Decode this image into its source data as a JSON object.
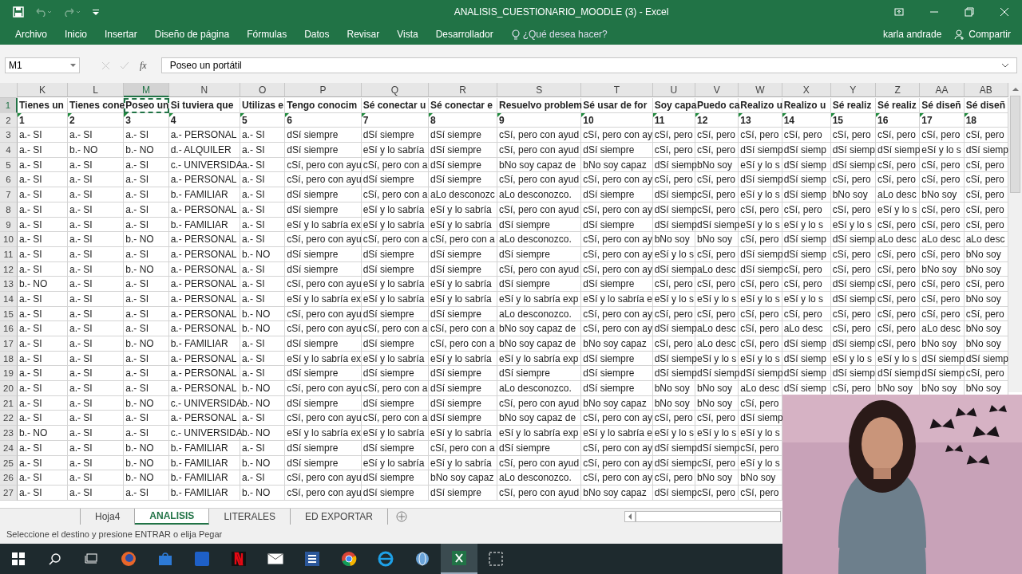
{
  "window": {
    "title": "ANALISIS_CUESTIONARIO_MOODLE (3) - Excel"
  },
  "ribbon": {
    "tabs": [
      {
        "label": "Archivo"
      },
      {
        "label": "Inicio"
      },
      {
        "label": "Insertar"
      },
      {
        "label": "Diseño de página"
      },
      {
        "label": "Fórmulas"
      },
      {
        "label": "Datos"
      },
      {
        "label": "Revisar"
      },
      {
        "label": "Vista"
      },
      {
        "label": "Desarrollador"
      }
    ],
    "tell_me": "¿Qué desea hacer?",
    "user": "karla andrade",
    "share": "Compartir"
  },
  "formula_bar": {
    "name_box": "M1",
    "function_label": "fx",
    "formula": "Poseo un portátil"
  },
  "sheet": {
    "columns": [
      {
        "label": "K",
        "selected": false
      },
      {
        "label": "L",
        "selected": false
      },
      {
        "label": "M",
        "selected": true
      },
      {
        "label": "N",
        "selected": false
      },
      {
        "label": "O",
        "selected": false
      },
      {
        "label": "P",
        "selected": false
      },
      {
        "label": "Q",
        "selected": false
      },
      {
        "label": "R",
        "selected": false
      },
      {
        "label": "S",
        "selected": false
      },
      {
        "label": "T",
        "selected": false
      },
      {
        "label": "U",
        "selected": false
      },
      {
        "label": "V",
        "selected": false
      },
      {
        "label": "W",
        "selected": false
      },
      {
        "label": "X",
        "selected": false
      },
      {
        "label": "Y",
        "selected": false
      },
      {
        "label": "Z",
        "selected": false
      },
      {
        "label": "AA",
        "selected": false
      },
      {
        "label": "AB",
        "selected": false
      }
    ],
    "rows": [
      {
        "number": "1",
        "selected": true,
        "kind": "header",
        "cells": [
          "Tienes un",
          "Tienes cone",
          "Poseo un",
          "Si tuviera que",
          "Utilizas e",
          "Tengo conocim",
          "Sé conectar u",
          "Sé conectar e",
          "Resuelvo problem",
          "Sé usar de for",
          "Soy capa",
          "Puedo ca",
          "Realizo u",
          "Realizo u",
          "Sé realiz",
          "Sé realiz",
          "Sé diseñ",
          "Sé diseñ"
        ]
      },
      {
        "number": "2",
        "selected": false,
        "kind": "number",
        "cells": [
          "1",
          "2",
          "3",
          "4",
          "5",
          "6",
          "7",
          "8",
          "9",
          "10",
          "11",
          "12",
          "13",
          "14",
          "15",
          "16",
          "17",
          "18"
        ]
      },
      {
        "number": "3",
        "selected": false,
        "kind": "data",
        "cells": [
          "a.- SI",
          "a.- SI",
          "a.- SI",
          "a.- PERSONAL",
          "a.- SI",
          "dSí siempre",
          "dSí siempre",
          "dSí siempre",
          "cSí, pero con ayud",
          "cSí, pero con ay",
          "cSí, pero",
          "cSí, pero",
          "cSí, pero",
          "cSí, pero",
          "cSí, pero",
          "cSí, pero",
          "cSí, pero",
          "cSí, pero"
        ]
      },
      {
        "number": "4",
        "selected": false,
        "kind": "data",
        "cells": [
          "a.- SI",
          "b.- NO",
          "b.- NO",
          "d.- ALQUILER",
          "a.- SI",
          "dSí siempre",
          "eSí y lo sabría",
          "dSí siempre",
          "cSí, pero con ayud",
          "dSí siempre",
          "cSí, pero",
          "cSí, pero",
          "dSí siemp",
          "dSí siemp",
          "dSí siemp",
          "dSí siemp",
          "eSí y lo s",
          "dSí siemp"
        ]
      },
      {
        "number": "5",
        "selected": false,
        "kind": "data",
        "cells": [
          "a.- SI",
          "a.- SI",
          "a.- SI",
          "c.- UNIVERSIDA",
          "a.- SI",
          "cSí, pero con ayu",
          "cSí, pero con a",
          "dSí siempre",
          "bNo soy capaz de",
          "bNo soy capaz",
          "dSí siemp",
          "bNo soy",
          "eSí y lo s",
          "dSí siemp",
          "dSí siemp",
          "cSí, pero",
          "cSí, pero",
          "cSí, pero"
        ]
      },
      {
        "number": "6",
        "selected": false,
        "kind": "data",
        "cells": [
          "a.- SI",
          "a.- SI",
          "a.- SI",
          "a.- PERSONAL",
          "a.- SI",
          "cSí, pero con ayu",
          "dSí siempre",
          "dSí siempre",
          "cSí, pero con ayud",
          "cSí, pero con ay",
          "cSí, pero",
          "cSí, pero",
          "dSí siemp",
          "dSí siemp",
          "cSí, pero",
          "cSí, pero",
          "cSí, pero",
          "cSí, pero"
        ]
      },
      {
        "number": "7",
        "selected": false,
        "kind": "data",
        "cells": [
          "a.- SI",
          "a.- SI",
          "a.- SI",
          "b.- FAMILIAR",
          "a.- SI",
          "dSí siempre",
          "cSí, pero con a",
          "aLo desconozc",
          "aLo desconozco.",
          "dSí siempre",
          "dSí siemp",
          "cSí, pero",
          "eSí y lo s",
          "dSí siemp",
          "bNo soy",
          "aLo desc",
          "bNo soy",
          "cSí, pero"
        ]
      },
      {
        "number": "8",
        "selected": false,
        "kind": "data",
        "cells": [
          "a.- SI",
          "a.- SI",
          "a.- SI",
          "a.- PERSONAL",
          "a.- SI",
          "dSí siempre",
          "eSí y lo sabría",
          "eSí y lo sabría",
          "cSí, pero con ayud",
          "cSí, pero con ay",
          "dSí siemp",
          "cSí, pero",
          "cSí, pero",
          "cSí, pero",
          "cSí, pero",
          "eSí y lo s",
          "cSí, pero",
          "cSí, pero"
        ]
      },
      {
        "number": "9",
        "selected": false,
        "kind": "data",
        "cells": [
          "a.- SI",
          "a.- SI",
          "a.- SI",
          "b.- FAMILIAR",
          "a.- SI",
          "eSí y lo sabría ex",
          "eSí y lo sabría",
          "eSí y lo sabría",
          "dSí siempre",
          "dSí siempre",
          "dSí siemp",
          "dSí siemp",
          "eSí y lo s",
          "eSí y lo s",
          "eSí y lo s",
          "cSí, pero",
          "cSí, pero",
          "cSí, pero"
        ]
      },
      {
        "number": "10",
        "selected": false,
        "kind": "data",
        "cells": [
          "a.- SI",
          "a.- SI",
          "b.- NO",
          "a.- PERSONAL",
          "a.- SI",
          "cSí, pero con ayu",
          "cSí, pero con a",
          "cSí, pero con a",
          "aLo desconozco.",
          "cSí, pero con ay",
          "bNo soy",
          "bNo soy",
          "cSí, pero",
          "dSí siemp",
          "dSí siemp",
          "aLo desc",
          "aLo desc",
          "aLo desc"
        ]
      },
      {
        "number": "11",
        "selected": false,
        "kind": "data",
        "cells": [
          "a.- SI",
          "a.- SI",
          "a.- SI",
          "a.- PERSONAL",
          "b.- NO",
          "dSí siempre",
          "dSí siempre",
          "dSí siempre",
          "dSí siempre",
          "cSí, pero con ay",
          "eSí y lo s",
          "cSí, pero",
          "dSí siemp",
          "dSí siemp",
          "cSí, pero",
          "cSí, pero",
          "cSí, pero",
          "bNo soy"
        ]
      },
      {
        "number": "12",
        "selected": false,
        "kind": "data",
        "cells": [
          "a.- SI",
          "a.- SI",
          "b.- NO",
          "a.- PERSONAL",
          "a.- SI",
          "dSí siempre",
          "dSí siempre",
          "dSí siempre",
          "cSí, pero con ayud",
          "cSí, pero con ay",
          "dSí siemp",
          "aLo desc",
          "dSí siemp",
          "cSí, pero",
          "cSí, pero",
          "cSí, pero",
          "bNo soy",
          "bNo soy"
        ]
      },
      {
        "number": "13",
        "selected": false,
        "kind": "data",
        "cells": [
          "b.- NO",
          "a.- SI",
          "a.- SI",
          "a.- PERSONAL",
          "a.- SI",
          "cSí, pero con ayu",
          "eSí y lo sabría",
          "eSí y lo sabría",
          "dSí siempre",
          "dSí siempre",
          "cSí, pero",
          "cSí, pero",
          "cSí, pero",
          "cSí, pero",
          "dSí siemp",
          "cSí, pero",
          "cSí, pero",
          "cSí, pero"
        ]
      },
      {
        "number": "14",
        "selected": false,
        "kind": "data",
        "cells": [
          "a.- SI",
          "a.- SI",
          "a.- SI",
          "a.- PERSONAL",
          "a.- SI",
          "eSí y lo sabría ex",
          "eSí y lo sabría",
          "eSí y lo sabría",
          "eSí y lo sabría exp",
          "eSí y lo sabría e",
          "eSí y lo s",
          "eSí y lo s",
          "eSí y lo s",
          "eSí y lo s",
          "dSí siemp",
          "cSí, pero",
          "cSí, pero",
          "bNo soy"
        ]
      },
      {
        "number": "15",
        "selected": false,
        "kind": "data",
        "cells": [
          "a.- SI",
          "a.- SI",
          "a.- SI",
          "a.- PERSONAL",
          "b.- NO",
          "cSí, pero con ayu",
          "dSí siempre",
          "dSí siempre",
          "aLo desconozco.",
          "cSí, pero con ay",
          "cSí, pero",
          "cSí, pero",
          "cSí, pero",
          "cSí, pero",
          "cSí, pero",
          "cSí, pero",
          "cSí, pero",
          "cSí, pero"
        ]
      },
      {
        "number": "16",
        "selected": false,
        "kind": "data",
        "cells": [
          "a.- SI",
          "a.- SI",
          "a.- SI",
          "a.- PERSONAL",
          "b.- NO",
          "cSí, pero con ayu",
          "cSí, pero con a",
          "cSí, pero con a",
          "bNo soy capaz de",
          "cSí, pero con ay",
          "dSí siemp",
          "aLo desc",
          "cSí, pero",
          "aLo desc",
          "cSí, pero",
          "cSí, pero",
          "aLo desc",
          "bNo soy"
        ]
      },
      {
        "number": "17",
        "selected": false,
        "kind": "data",
        "cells": [
          "a.- SI",
          "a.- SI",
          "b.- NO",
          "b.- FAMILIAR",
          "a.- SI",
          "dSí siempre",
          "dSí siempre",
          "cSí, pero con a",
          "bNo soy capaz de",
          "bNo soy capaz",
          "cSí, pero",
          "aLo desc",
          "cSí, pero",
          "dSí siemp",
          "dSí siemp",
          "cSí, pero",
          "bNo soy",
          "bNo soy"
        ]
      },
      {
        "number": "18",
        "selected": false,
        "kind": "data",
        "cells": [
          "a.- SI",
          "a.- SI",
          "a.- SI",
          "a.- PERSONAL",
          "a.- SI",
          "eSí y lo sabría ex",
          "eSí y lo sabría",
          "eSí y lo sabría",
          "eSí y lo sabría exp",
          "dSí siempre",
          "dSí siemp",
          "eSí y lo s",
          "eSí y lo s",
          "dSí siemp",
          "eSí y lo s",
          "eSí y lo s",
          "dSí siemp",
          "dSí siemp"
        ]
      },
      {
        "number": "19",
        "selected": false,
        "kind": "data",
        "cells": [
          "a.- SI",
          "a.- SI",
          "a.- SI",
          "a.- PERSONAL",
          "a.- SI",
          "dSí siempre",
          "dSí siempre",
          "dSí siempre",
          "dSí siempre",
          "dSí siempre",
          "dSí siemp",
          "dSí siemp",
          "dSí siemp",
          "dSí siemp",
          "dSí siemp",
          "dSí siemp",
          "dSí siemp",
          "cSí, pero"
        ]
      },
      {
        "number": "20",
        "selected": false,
        "kind": "data",
        "cells": [
          "a.- SI",
          "a.- SI",
          "a.- SI",
          "a.- PERSONAL",
          "b.- NO",
          "cSí, pero con ayu",
          "cSí, pero con a",
          "dSí siempre",
          "aLo desconozco.",
          "dSí siempre",
          "bNo soy",
          "bNo soy",
          "aLo desc",
          "dSí siemp",
          "cSí, pero",
          "bNo soy",
          "bNo soy",
          "bNo soy"
        ]
      },
      {
        "number": "21",
        "selected": false,
        "kind": "data",
        "cells": [
          "a.- SI",
          "a.- SI",
          "b.- NO",
          "c.- UNIVERSIDA",
          "b.- NO",
          "dSí siempre",
          "dSí siempre",
          "dSí siempre",
          "cSí, pero con ayud",
          "bNo soy capaz",
          "bNo soy",
          "bNo soy",
          "cSí, pero"
        ]
      },
      {
        "number": "22",
        "selected": false,
        "kind": "data",
        "cells": [
          "a.- SI",
          "a.- SI",
          "a.- SI",
          "a.- PERSONAL",
          "a.- SI",
          "cSí, pero con ayu",
          "cSí, pero con a",
          "dSí siempre",
          "bNo soy capaz de",
          "cSí, pero con ay",
          "cSí, pero",
          "cSí, pero",
          "dSí siemp"
        ]
      },
      {
        "number": "23",
        "selected": false,
        "kind": "data",
        "cells": [
          "b.- NO",
          "a.- SI",
          "a.- SI",
          "c.- UNIVERSIDA",
          "b.- NO",
          "eSí y lo sabría ex",
          "eSí y lo sabría",
          "eSí y lo sabría",
          "eSí y lo sabría exp",
          "eSí y lo sabría e",
          "eSí y lo s",
          "eSí y lo s",
          "eSí y lo s"
        ]
      },
      {
        "number": "24",
        "selected": false,
        "kind": "data",
        "cells": [
          "a.- SI",
          "a.- SI",
          "b.- NO",
          "b.- FAMILIAR",
          "a.- SI",
          "dSí siempre",
          "dSí siempre",
          "cSí, pero con a",
          "dSí siempre",
          "cSí, pero con ay",
          "dSí siemp",
          "dSí siemp",
          "cSí, pero"
        ]
      },
      {
        "number": "25",
        "selected": false,
        "kind": "data",
        "cells": [
          "a.- SI",
          "a.- SI",
          "b.- NO",
          "b.- FAMILIAR",
          "b.- NO",
          "dSí siempre",
          "eSí y lo sabría",
          "eSí y lo sabría",
          "cSí, pero con ayud",
          "cSí, pero con ay",
          "dSí siemp",
          "cSí, pero",
          "eSí y lo s"
        ]
      },
      {
        "number": "26",
        "selected": false,
        "kind": "data",
        "cells": [
          "a.- SI",
          "a.- SI",
          "b.- NO",
          "b.- FAMILIAR",
          "a.- SI",
          "cSí, pero con ayu",
          "dSí siempre",
          "bNo soy capaz",
          "aLo desconozco.",
          "cSí, pero con ay",
          "cSí, pero",
          "bNo soy",
          "bNo soy"
        ]
      },
      {
        "number": "27",
        "selected": false,
        "kind": "data",
        "cells": [
          "a.- SI",
          "a.- SI",
          "a.- SI",
          "b.- FAMILIAR",
          "b.- NO",
          "cSí, pero con ayu",
          "dSí siempre",
          "dSí siempre",
          "cSí, pero con ayud",
          "bNo soy capaz",
          "dSí siemp",
          "cSí, pero",
          "cSí, pero"
        ]
      }
    ]
  },
  "sheet_tabs": [
    {
      "label": "Hoja4",
      "selected": false
    },
    {
      "label": "ANALISIS",
      "selected": true
    },
    {
      "label": "LITERALES",
      "selected": false
    },
    {
      "label": "ED EXPORTAR",
      "selected": false
    }
  ],
  "status_bar": {
    "message": "Seleccione el destino y presione ENTRAR o elija Pegar"
  }
}
